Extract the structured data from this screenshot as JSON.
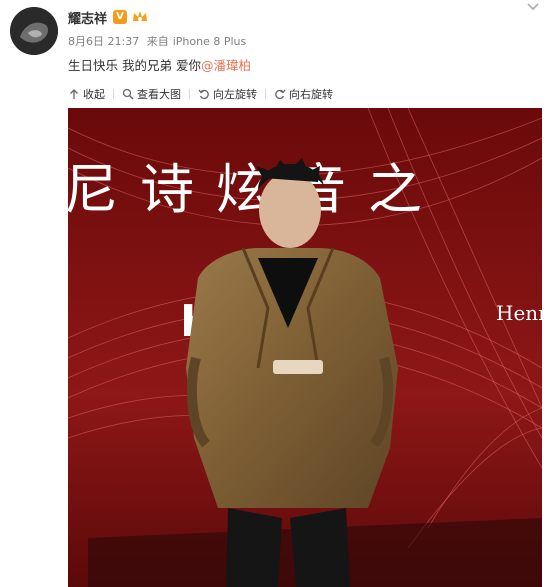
{
  "post": {
    "username": "耀志祥",
    "verified_badge": "V",
    "date": "8月6日 21:37",
    "source_prefix": "来自",
    "source": "iPhone 8 Plus",
    "text_before_mention": "生日快乐 我的兄弟 爱你",
    "mention": "@潘瑋柏"
  },
  "toolbar": {
    "collect": "收起",
    "view_large": "查看大图",
    "rotate_left": "向左旋转",
    "rotate_right": "向右旋转"
  },
  "photo": {
    "banner_text": "尼诗炫音之",
    "brand_text": "Henr"
  },
  "colors": {
    "mention": "#eb7350",
    "verified": "#f49b1a",
    "photo_background": "#7a0f0f"
  },
  "icons": [
    "collapse-icon",
    "magnify-icon",
    "rotate-left-icon",
    "rotate-right-icon",
    "member-crown-icon",
    "menu-caret-icon"
  ]
}
